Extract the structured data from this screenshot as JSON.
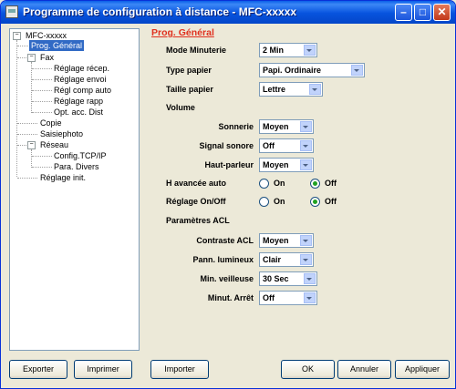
{
  "window": {
    "title": "Programme de configuration à distance - MFC-xxxxx",
    "minimize_glyph": "–",
    "maximize_glyph": "□",
    "close_glyph": "✕"
  },
  "tree": {
    "root": "MFC-xxxxx",
    "prog_general": "Prog. Général",
    "fax": "Fax",
    "fax_children": [
      "Réglage récep.",
      "Réglage envoi",
      "Régl comp auto",
      "Réglage rapp",
      "Opt. acc. Dist"
    ],
    "copie": "Copie",
    "saisiephoto": "Saisiephoto",
    "reseau": "Réseau",
    "reseau_children": [
      "Config.TCP/IP",
      "Para. Divers"
    ],
    "reglage_init": "Réglage init.",
    "expand_glyph": "−"
  },
  "panel": {
    "title": "Prog. Général",
    "mode_minuterie": {
      "label": "Mode Minuterie",
      "value": "2 Min"
    },
    "type_papier": {
      "label": "Type papier",
      "value": "Papi. Ordinaire"
    },
    "taille_papier": {
      "label": "Taille papier",
      "value": "Lettre"
    },
    "volume_heading": "Volume",
    "sonnerie": {
      "label": "Sonnerie",
      "value": "Moyen"
    },
    "signal_sonore": {
      "label": "Signal sonore",
      "value": "Off"
    },
    "haut_parleur": {
      "label": "Haut-parleur",
      "value": "Moyen"
    },
    "h_avancee_auto": {
      "label": "H avancée auto",
      "on": "On",
      "off": "Off",
      "selected": "Off"
    },
    "reglage_on_off": {
      "label": "Réglage On/Off",
      "on": "On",
      "off": "Off",
      "selected": "Off"
    },
    "acl_heading": "Paramètres ACL",
    "contraste_acl": {
      "label": "Contraste ACL",
      "value": "Moyen"
    },
    "pann_lumineux": {
      "label": "Pann. lumineux",
      "value": "Clair"
    },
    "min_veilleuse": {
      "label": "Min. veilleuse",
      "value": "30 Sec"
    },
    "minut_arret": {
      "label": "Minut. Arrêt",
      "value": "Off"
    }
  },
  "buttons": {
    "exporter": "Exporter",
    "imprimer": "Imprimer",
    "importer": "Importer",
    "ok": "OK",
    "annuler": "Annuler",
    "appliquer": "Appliquer"
  },
  "colors": {
    "titlebar": "#0753de",
    "section_title": "#e0301e",
    "tree_selection": "#316ac5",
    "radio_dot": "#21a121"
  }
}
